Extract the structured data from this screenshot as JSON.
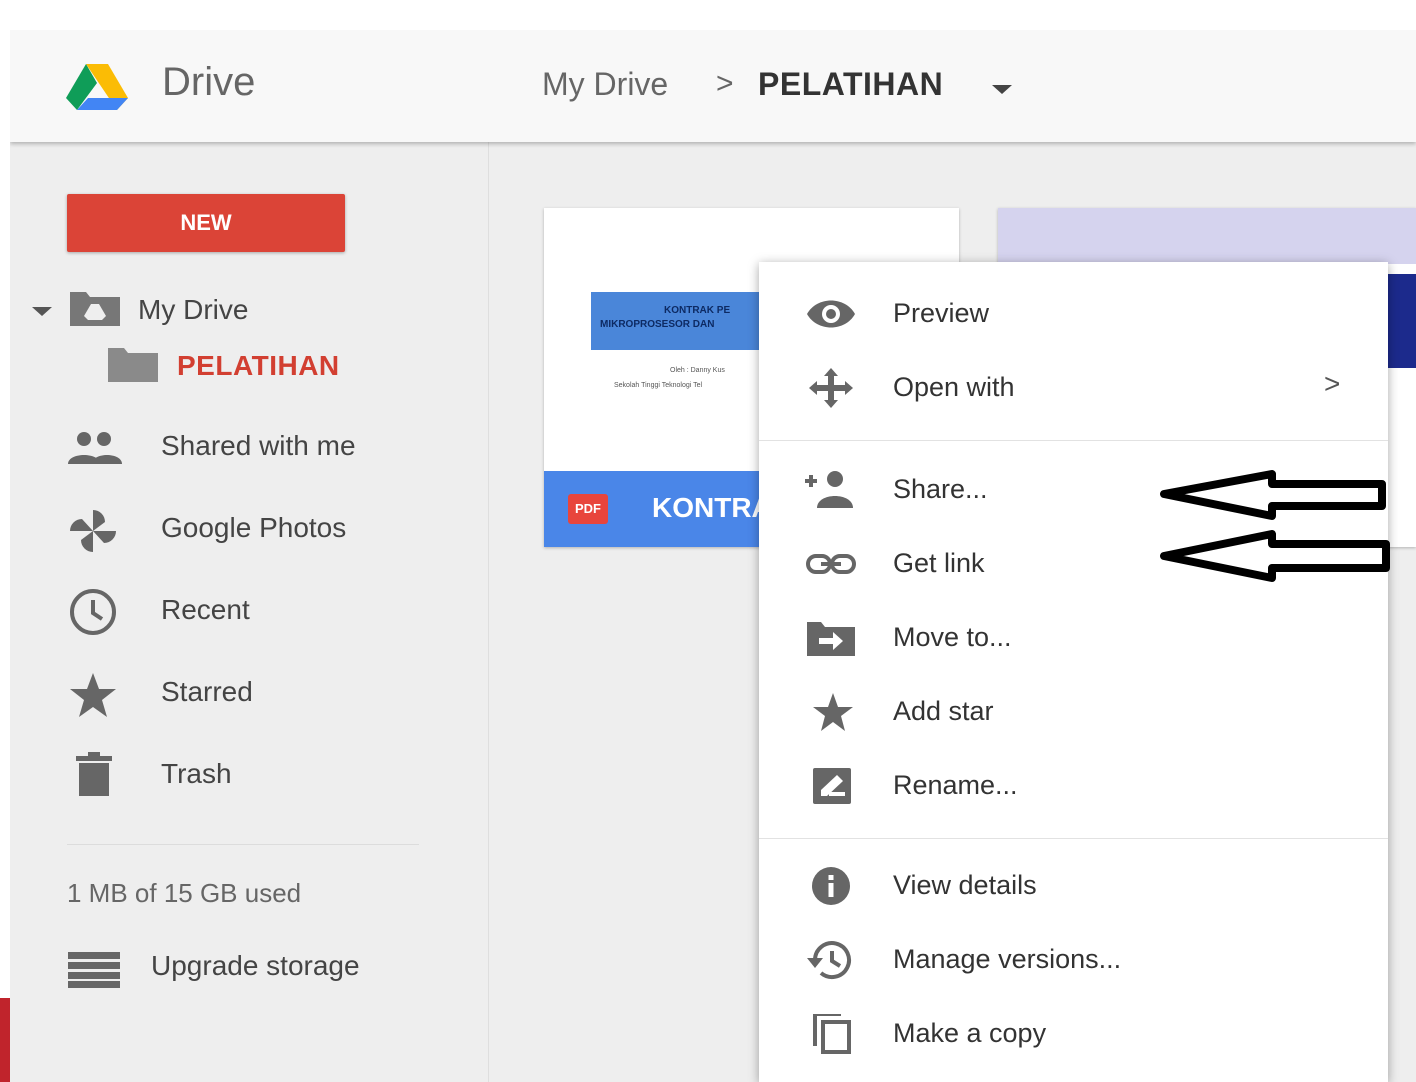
{
  "app": {
    "name": "Drive"
  },
  "breadcrumb": {
    "root": "My Drive",
    "separator": ">",
    "current": "PELATIHAN"
  },
  "sidebar": {
    "new_label": "NEW",
    "tree_root": "My Drive",
    "tree_child": "PELATIHAN",
    "items": [
      {
        "label": "Shared with me",
        "icon": "people-icon"
      },
      {
        "label": "Google Photos",
        "icon": "photos-pinwheel-icon"
      },
      {
        "label": "Recent",
        "icon": "clock-icon"
      },
      {
        "label": "Starred",
        "icon": "star-icon"
      },
      {
        "label": "Trash",
        "icon": "trash-icon"
      }
    ],
    "storage_text": "1 MB of 15 GB used",
    "upgrade_label": "Upgrade storage"
  },
  "file": {
    "type_badge": "PDF",
    "name": "KONTRA",
    "thumb_title_1": "KONTRAK PE",
    "thumb_title_2": "MIKROPROSESOR DAN",
    "thumb_line_1": "Oleh : Danny Kus",
    "thumb_line_2": "Sekolah Tinggi Teknologi Tel"
  },
  "context_menu": {
    "items": [
      {
        "label": "Preview",
        "icon": "eye-icon"
      },
      {
        "label": "Open with",
        "icon": "move-arrows-icon",
        "submenu_arrow": ">"
      },
      {
        "label": "Share...",
        "icon": "person-add-icon"
      },
      {
        "label": "Get link",
        "icon": "link-icon"
      },
      {
        "label": "Move to...",
        "icon": "folder-move-icon"
      },
      {
        "label": "Add star",
        "icon": "star-icon"
      },
      {
        "label": "Rename...",
        "icon": "pencil-icon"
      },
      {
        "label": "View details",
        "icon": "info-icon"
      },
      {
        "label": "Manage versions...",
        "icon": "history-icon"
      },
      {
        "label": "Make a copy",
        "icon": "copy-icon"
      }
    ]
  },
  "colors": {
    "new_button": "#db4437",
    "selected_folder_text": "#d23f31",
    "file_footer": "#4a86e8"
  }
}
